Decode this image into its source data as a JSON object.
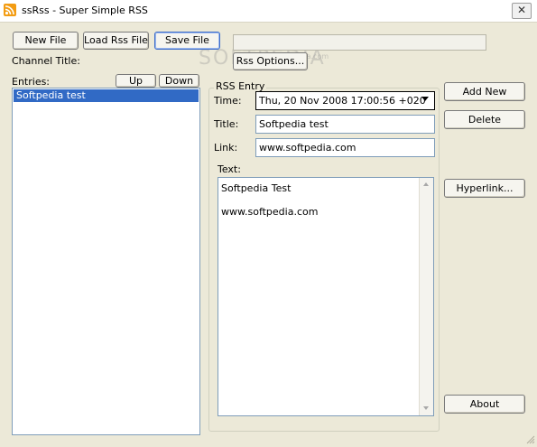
{
  "window": {
    "title": "ssRss - Super Simple RSS",
    "close_glyph": "✕",
    "icon": "rss-icon",
    "accent": "#f39c12"
  },
  "toolbar": {
    "new_file": "New File",
    "load_rss_file": "Load Rss File",
    "save_file": "Save File",
    "rss_options": "Rss Options..."
  },
  "channel": {
    "title_label": "Channel Title:"
  },
  "entries": {
    "label": "Entries:",
    "up": "Up",
    "down": "Down",
    "items": [
      "Softpedia test"
    ],
    "selected_color": "#316ac5"
  },
  "rss_entry": {
    "group_label": "RSS Entry",
    "time_label": "Time:",
    "time_value": "Thu, 20 Nov 2008 17:00:56 +020",
    "title_label": "Title:",
    "title_value": "Softpedia test",
    "link_label": "Link:",
    "link_value": "www.softpedia.com",
    "text_label": "Text:",
    "text_lines": [
      "Softpedia Test",
      "",
      "www.softpedia.com"
    ]
  },
  "actions": {
    "add_new": "Add New",
    "delete": "Delete",
    "hyperlink": "Hyperlink...",
    "about": "About"
  },
  "watermark": {
    "main": "SOFTPEDIA",
    "sub": "www.softpedia.com"
  }
}
